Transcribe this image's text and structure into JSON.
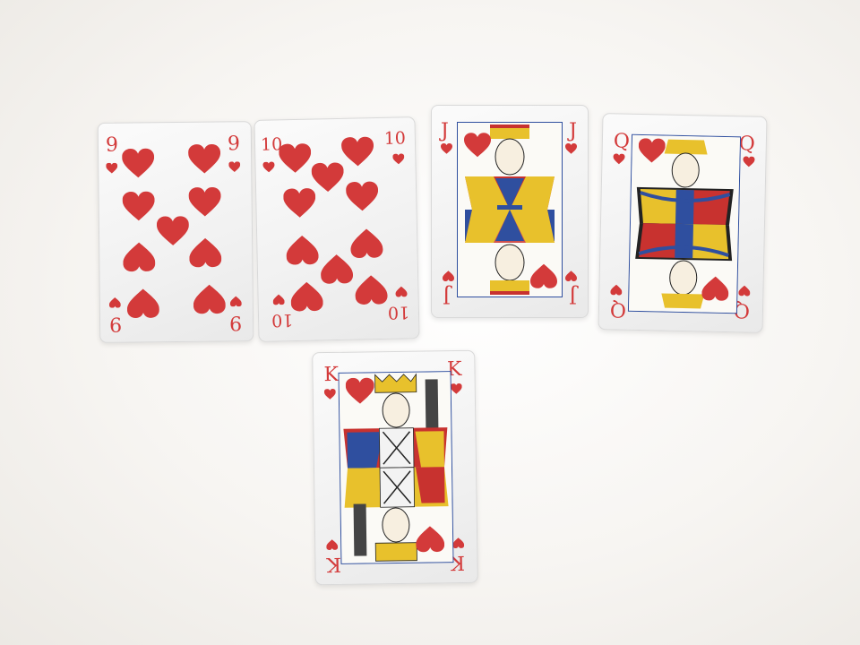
{
  "scene": {
    "background": "#f7f5f2",
    "suit": "hearts",
    "suit_color": "#d33a3a",
    "court_blue": "#2f4f9f",
    "court_yellow": "#e8c12c",
    "court_red": "#c8322f"
  },
  "cards": [
    {
      "rank": "9",
      "suit": "hearts"
    },
    {
      "rank": "10",
      "suit": "hearts"
    },
    {
      "rank": "J",
      "suit": "hearts",
      "court": "jack"
    },
    {
      "rank": "Q",
      "suit": "hearts",
      "court": "queen"
    },
    {
      "rank": "K",
      "suit": "hearts",
      "court": "king"
    }
  ],
  "icons": {
    "pip": "heart-icon"
  }
}
